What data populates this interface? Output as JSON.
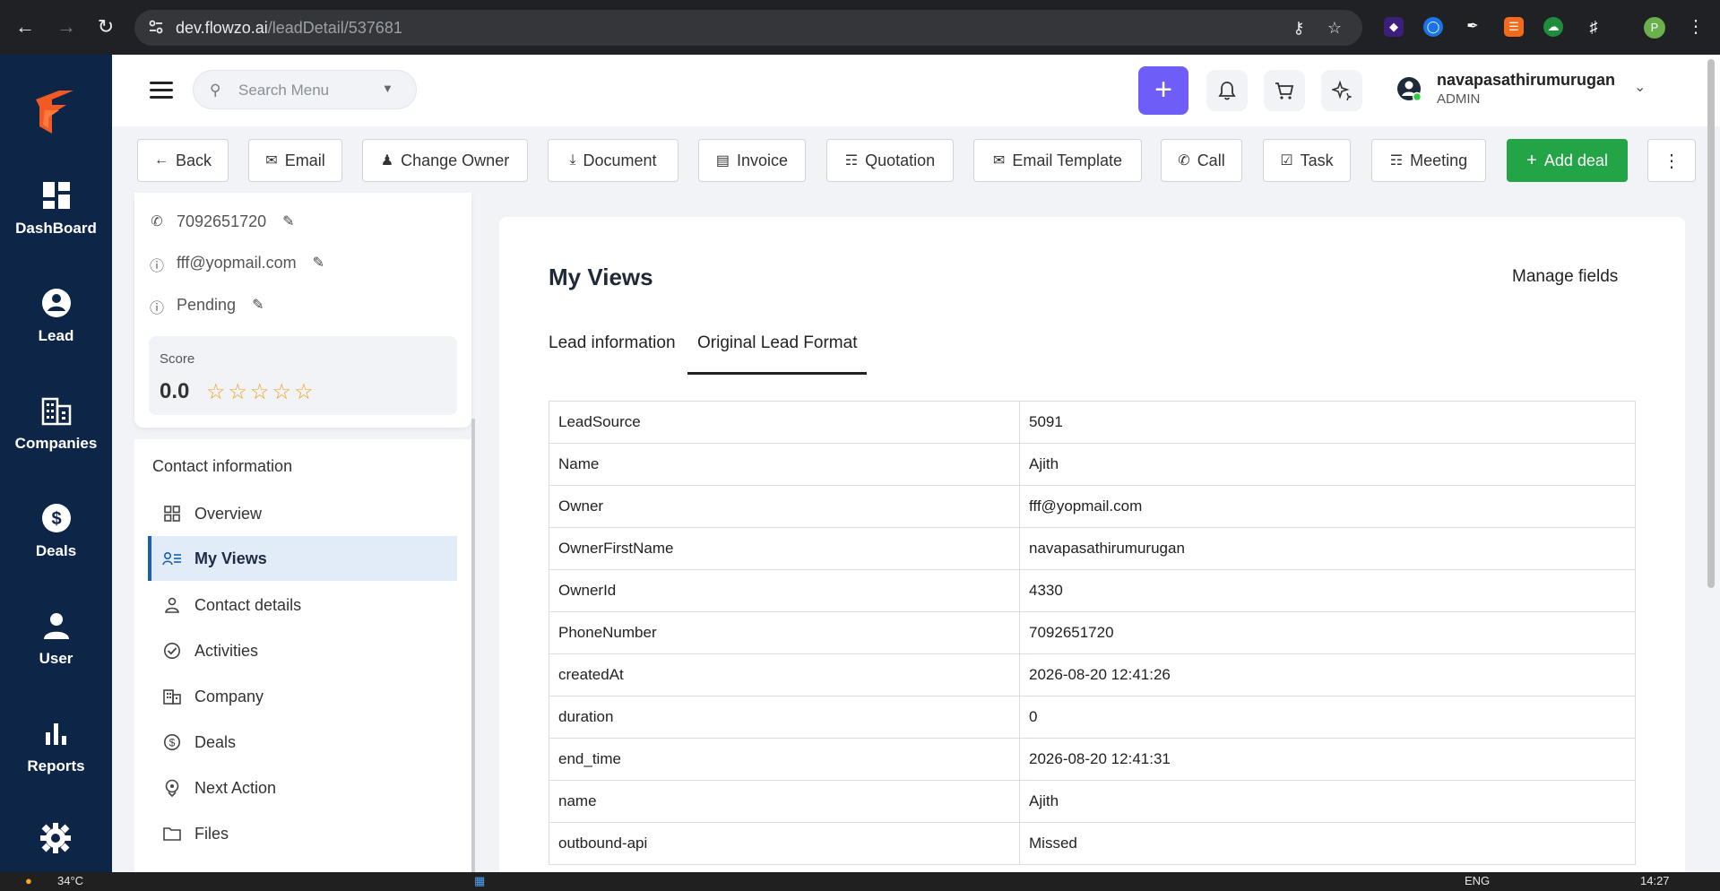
{
  "browser": {
    "url_host": "dev.flowzo.ai",
    "url_path": "/leadDetail/537681",
    "profile_initial": "P"
  },
  "rail": {
    "items": [
      {
        "label": "DashBoard",
        "icon": "dashboard-icon"
      },
      {
        "label": "Lead",
        "icon": "lead-icon"
      },
      {
        "label": "Companies",
        "icon": "companies-icon"
      },
      {
        "label": "Deals",
        "icon": "deals-icon"
      },
      {
        "label": "User",
        "icon": "user-icon"
      },
      {
        "label": "Reports",
        "icon": "reports-icon"
      }
    ]
  },
  "topbar": {
    "search_placeholder": "Search Menu",
    "user_name": "navapasathirumurugan",
    "user_role": "ADMIN"
  },
  "toolbar": {
    "back": "Back",
    "email": "Email",
    "change_owner": "Change Owner",
    "document": "Document",
    "invoice": "Invoice",
    "quotation": "Quotation",
    "email_template": "Email Template",
    "call": "Call",
    "task": "Task",
    "meeting": "Meeting",
    "add_deal": "Add deal"
  },
  "lead_card": {
    "phone": "7092651720",
    "email": "fff@yopmail.com",
    "status": "Pending",
    "score_label": "Score",
    "score_value": "0.0",
    "stars": "☆☆☆☆☆"
  },
  "contact_nav": {
    "heading": "Contact information",
    "items": [
      {
        "label": "Overview",
        "icon": "grid-icon"
      },
      {
        "label": "My Views",
        "icon": "my-views-icon"
      },
      {
        "label": "Contact details",
        "icon": "person-icon"
      },
      {
        "label": "Activities",
        "icon": "check-circle-icon"
      },
      {
        "label": "Company",
        "icon": "building-icon"
      },
      {
        "label": "Deals",
        "icon": "dollar-circle-icon"
      },
      {
        "label": "Next Action",
        "icon": "next-action-icon"
      },
      {
        "label": "Files",
        "icon": "folder-icon"
      }
    ]
  },
  "main": {
    "title": "My Views",
    "manage_fields": "Manage fields",
    "tabs": [
      {
        "label": "Lead information"
      },
      {
        "label": "Original Lead Format"
      }
    ],
    "rows": [
      {
        "key": "LeadSource",
        "value": "5091"
      },
      {
        "key": "Name",
        "value": "Ajith"
      },
      {
        "key": "Owner",
        "value": "fff@yopmail.com"
      },
      {
        "key": "OwnerFirstName",
        "value": "navapasathirumurugan"
      },
      {
        "key": "OwnerId",
        "value": "4330"
      },
      {
        "key": "PhoneNumber",
        "value": "7092651720"
      },
      {
        "key": "createdAt",
        "value": "2026-08-20 12:41:26"
      },
      {
        "key": "duration",
        "value": "0"
      },
      {
        "key": "end_time",
        "value": "2026-08-20 12:41:31"
      },
      {
        "key": "name",
        "value": "Ajith"
      },
      {
        "key": "outbound-api",
        "value": "Missed"
      }
    ]
  },
  "taskbar": {
    "temperature": "34°C",
    "lang": "ENG",
    "time": "14:27"
  }
}
